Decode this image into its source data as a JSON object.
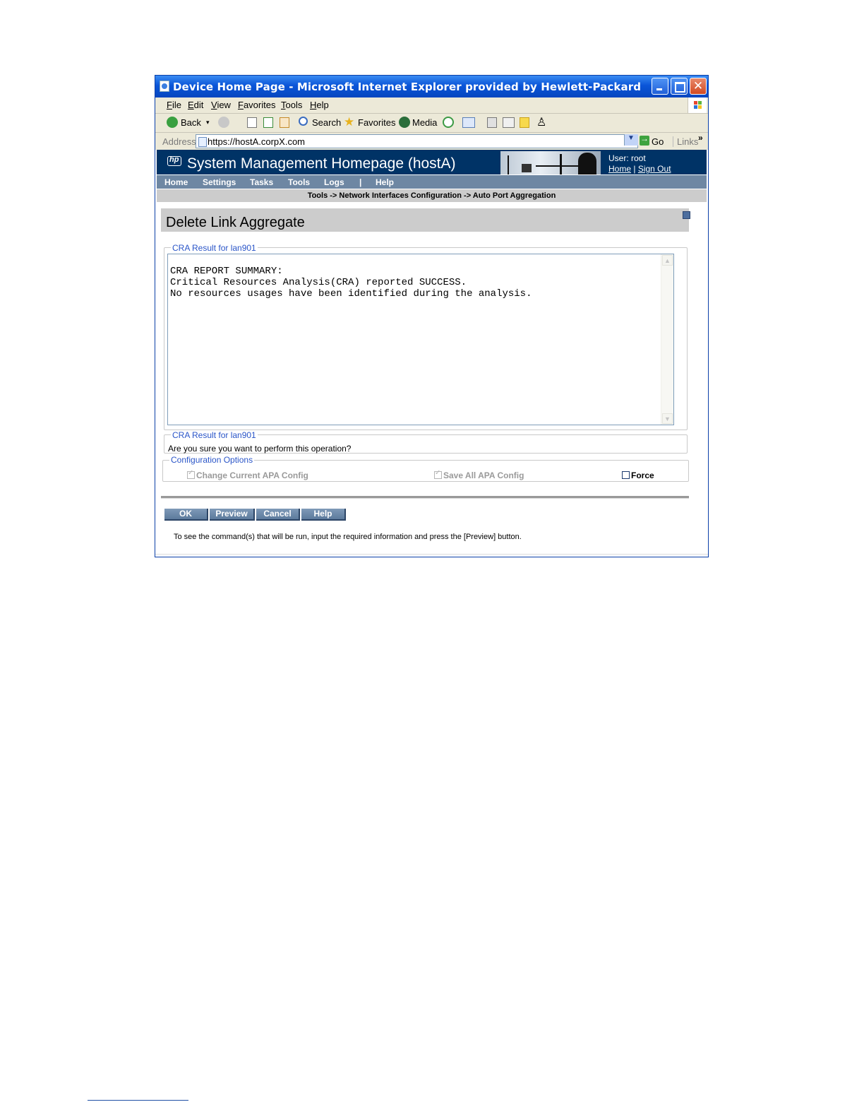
{
  "window": {
    "title": "Device Home Page - Microsoft Internet Explorer provided by Hewlett-Packard"
  },
  "menu": {
    "items": [
      "File",
      "Edit",
      "View",
      "Favorites",
      "Tools",
      "Help"
    ]
  },
  "toolbar": {
    "back": "Back",
    "search": "Search",
    "favorites": "Favorites",
    "media": "Media"
  },
  "address": {
    "label": "Address",
    "url": "https://hostA.corpX.com",
    "go": "Go",
    "links": "Links"
  },
  "app": {
    "title": "System Management Homepage (hostA)",
    "user": "User: root",
    "home_link": "Home",
    "link_separator": "|",
    "signout_link": "Sign Out",
    "logo": "hp"
  },
  "nav": {
    "items": [
      "Home",
      "Settings",
      "Tasks",
      "Tools",
      "Logs",
      "|",
      "Help"
    ]
  },
  "breadcrumb": "Tools -> Network Interfaces Configuration -> Auto Port Aggregation",
  "page": {
    "title": "Delete Link Aggregate"
  },
  "cra": {
    "legend": "CRA Result for lan901",
    "report": "CRA REPORT SUMMARY:\nCritical Resources Analysis(CRA) reported SUCCESS.\nNo resources usages have been identified during the analysis."
  },
  "confirm": {
    "legend": "CRA Result for lan901",
    "text": "Are you sure you want to perform this operation?"
  },
  "options": {
    "legend": "Configuration Options",
    "change_current": {
      "label": "Change Current APA Config",
      "checked": true,
      "enabled": false
    },
    "save_all": {
      "label": "Save All APA Config",
      "checked": true,
      "enabled": false
    },
    "force": {
      "label": "Force",
      "checked": false,
      "enabled": true
    }
  },
  "buttons": {
    "ok": "OK",
    "preview": "Preview",
    "cancel": "Cancel",
    "help": "Help"
  },
  "hint": "To see the command(s) that will be run, input the required information and press the [Preview] button.",
  "colors": {
    "title_bar": "#0a55d8",
    "header": "#003366",
    "nav": "#6e87a3",
    "legend": "#2a55c8"
  }
}
